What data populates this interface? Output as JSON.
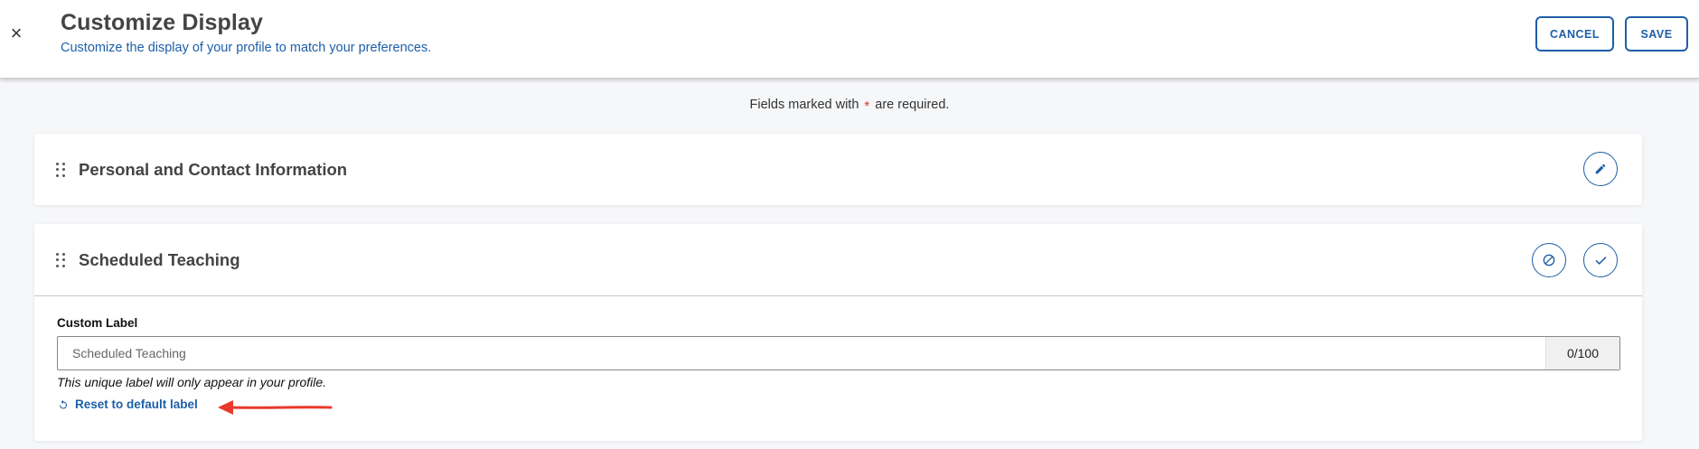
{
  "header": {
    "close_icon": "×",
    "title": "Customize Display",
    "subtitle": "Customize the display of your profile to match your preferences.",
    "cancel_label": "CANCEL",
    "save_label": "SAVE"
  },
  "required_note": {
    "prefix": "Fields marked with",
    "star": "*",
    "suffix": "are required."
  },
  "sections": [
    {
      "title": "Personal and Contact Information",
      "action_icon": "pencil-icon"
    },
    {
      "title": "Scheduled Teaching",
      "action_icons": [
        "cancel-circle-icon",
        "check-icon"
      ],
      "field": {
        "label": "Custom Label",
        "placeholder": "Scheduled Teaching",
        "value": "",
        "char_count": "0/100",
        "help_text": "This unique label will only appear in your profile.",
        "reset_label": "Reset to default label"
      }
    }
  ],
  "colors": {
    "accent": "#1d5fa8",
    "required_star": "#d9362b",
    "annotation_arrow": "#e8392b"
  }
}
